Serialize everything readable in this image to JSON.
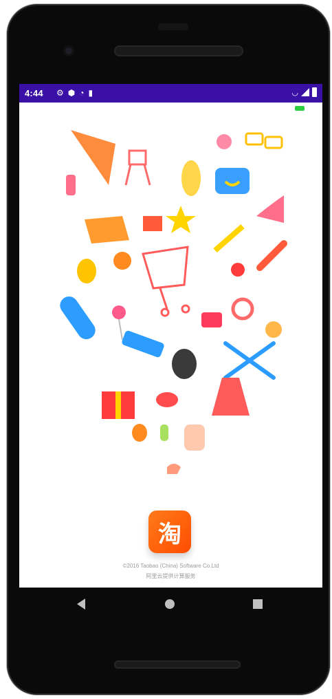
{
  "status_bar": {
    "time": "4:44",
    "left_icons": [
      "gear-icon",
      "shield-icon",
      "wifi-question-icon",
      "sim-icon"
    ],
    "right_icons": [
      "wifi-x-icon",
      "signal-icon",
      "battery-icon"
    ],
    "background": "#3b10a7"
  },
  "app": {
    "logo_char": "淘",
    "logo_color": "#ff5a00",
    "copyright": "©2016 Taobao (China) Software Co.Ltd",
    "service": "阿里云提供计算服务"
  },
  "nav_bar": {
    "items": [
      "back-icon",
      "home-icon",
      "recents-icon"
    ]
  }
}
